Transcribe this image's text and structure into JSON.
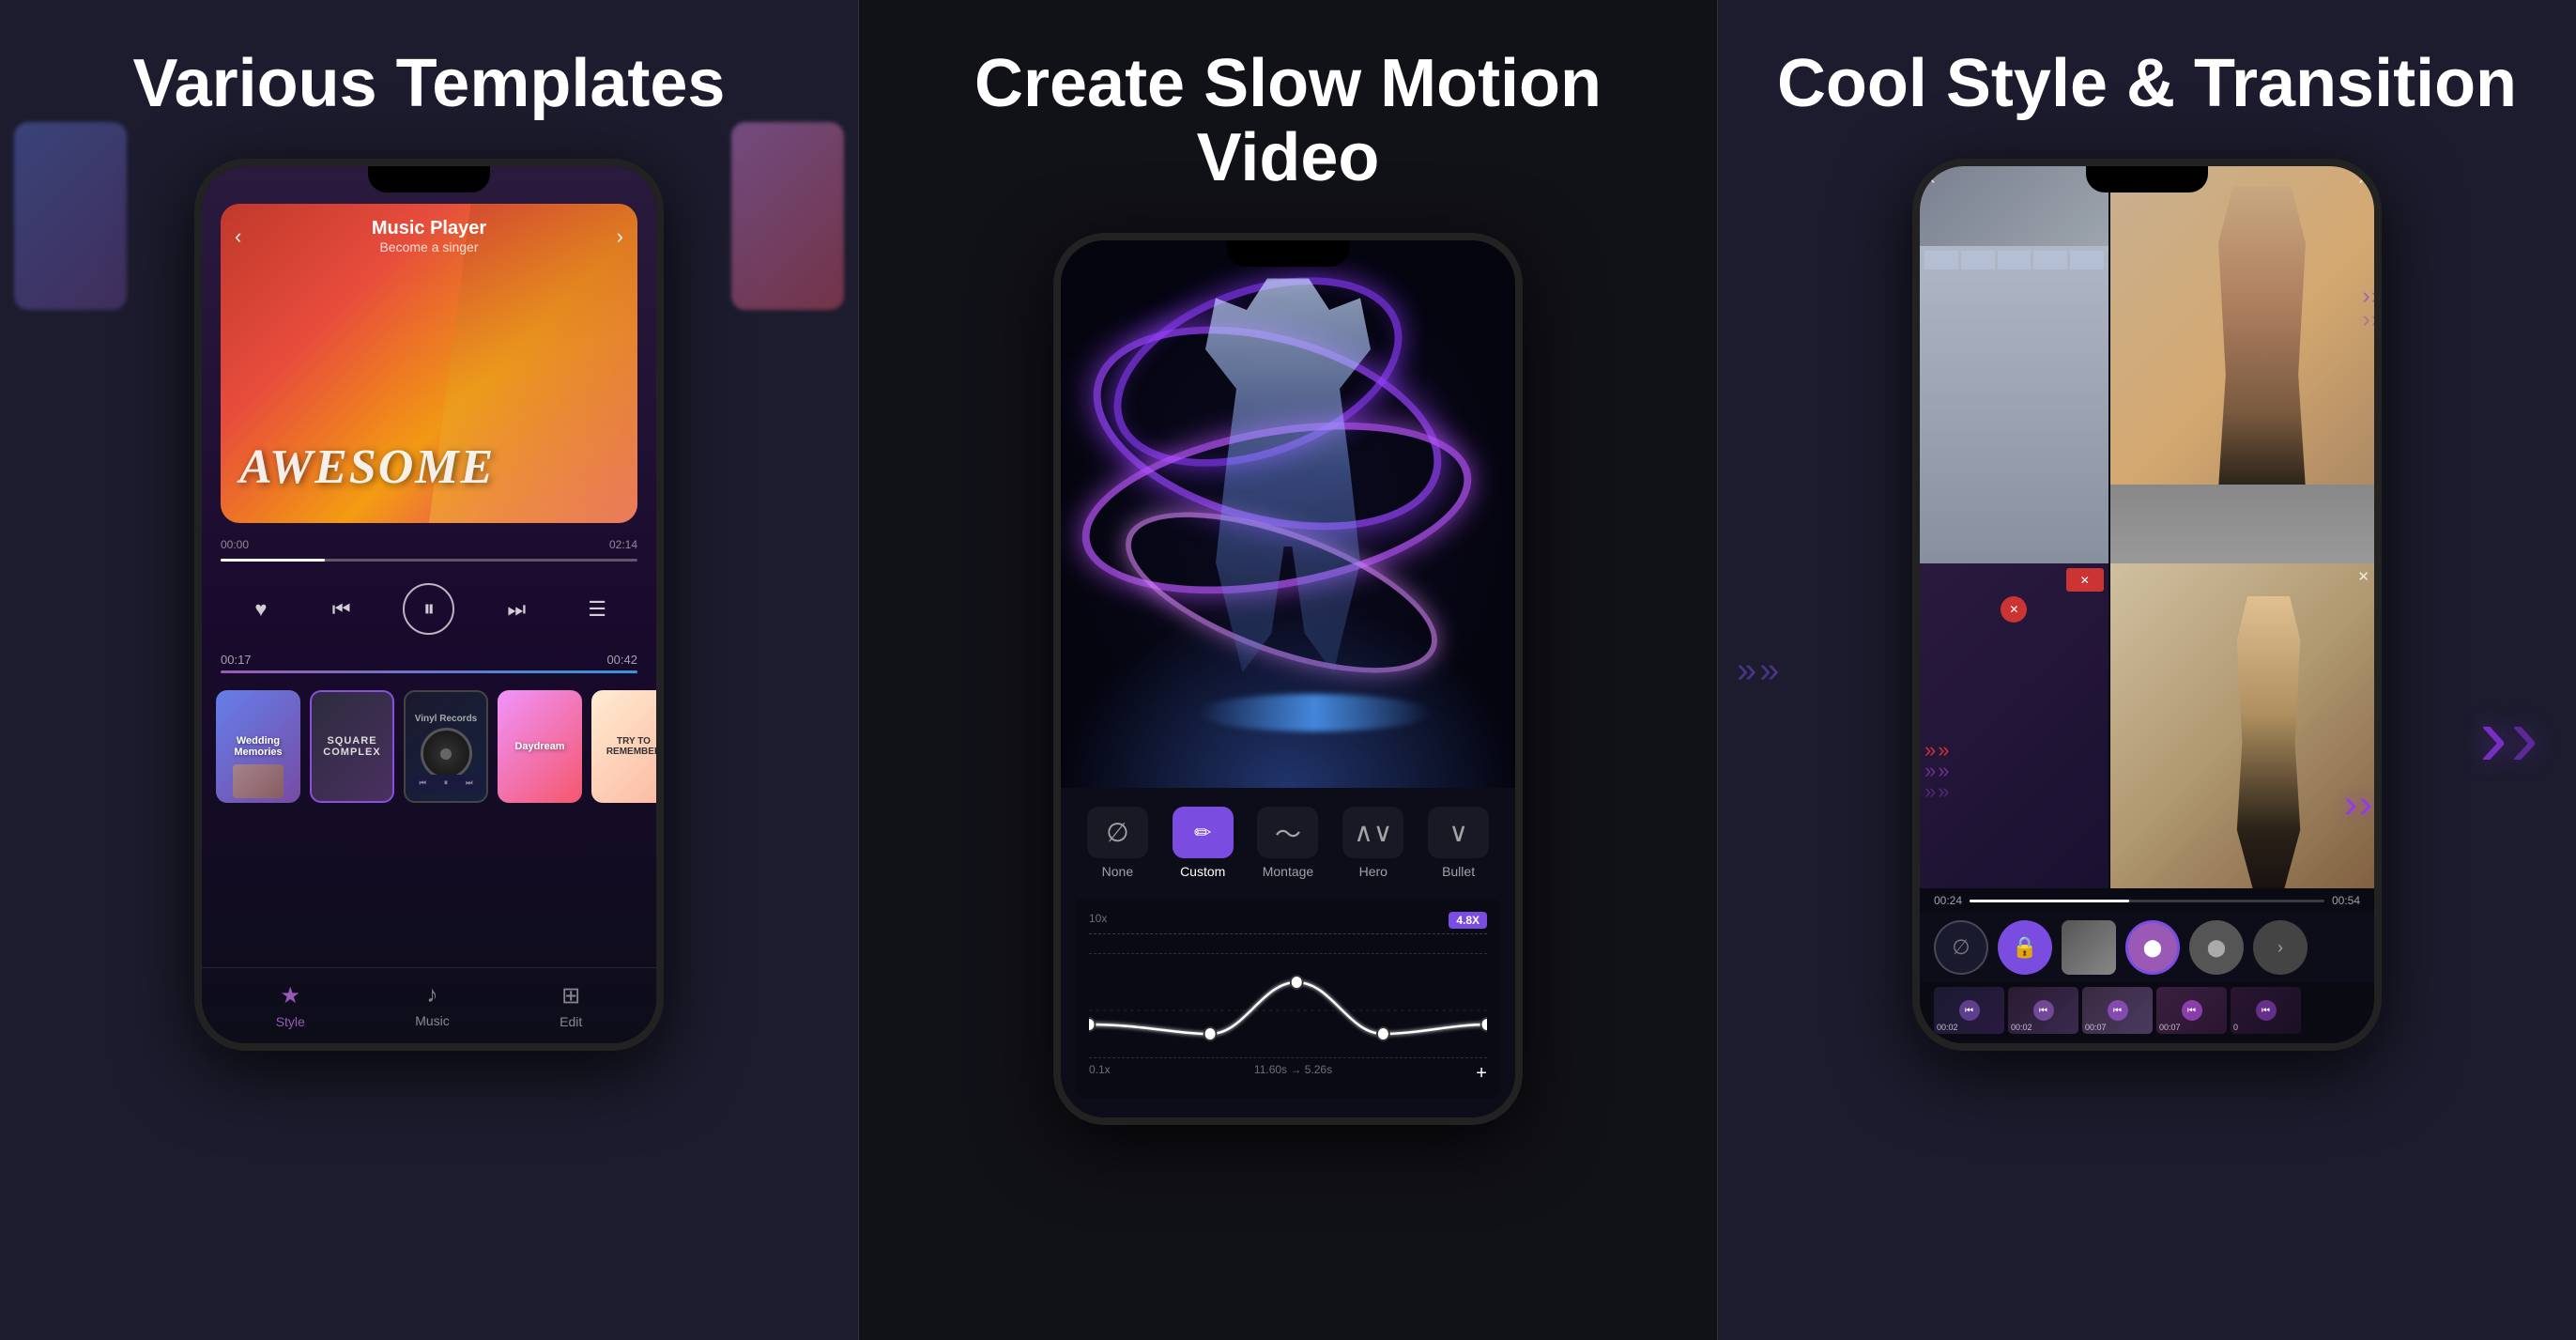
{
  "panels": [
    {
      "id": "panel-1",
      "title": "Various Templates",
      "phone": {
        "musicPlayer": {
          "trackName": "Music Player",
          "trackSub": "Become a singer",
          "awesomeText": "AWESOME",
          "timeStart": "00:17",
          "timeEnd": "00:42",
          "progressStart": "00:00",
          "progressEnd": "02:14"
        },
        "templates": [
          {
            "label": "Wedding\nMemories",
            "style": "wedding"
          },
          {
            "label": "SQUARE\nCOMPLEX",
            "style": "square"
          },
          {
            "label": "Vinyl Records",
            "style": "vinyl"
          },
          {
            "label": "Daydream",
            "style": "daydream"
          },
          {
            "label": "TRY TO\nREMEMBER",
            "style": "try"
          }
        ],
        "nav": [
          {
            "label": "Style",
            "icon": "★",
            "active": true
          },
          {
            "label": "Music",
            "icon": "♪",
            "active": false
          },
          {
            "label": "Edit",
            "icon": "⊞",
            "active": false
          }
        ]
      }
    },
    {
      "id": "panel-2",
      "title": "Create Slow Motion Video",
      "phone": {
        "speedOptions": [
          {
            "label": "None",
            "icon": "∅",
            "active": false
          },
          {
            "label": "Custom",
            "icon": "✏",
            "active": true
          },
          {
            "label": "Montage",
            "icon": "~",
            "active": false
          },
          {
            "label": "Hero",
            "icon": "^",
            "active": false
          },
          {
            "label": "Bullet",
            "icon": "∨",
            "active": false
          }
        ],
        "graph": {
          "topLeft": "10x",
          "badge": "4.8X",
          "bottomLeft": "0.1x",
          "timeLabel": "11.60s → 5.26s",
          "plusBtn": "+"
        }
      }
    },
    {
      "id": "panel-3",
      "title": "Cool Style & Transition",
      "phone": {
        "timeline": {
          "timeStart": "00:24",
          "timeEnd": "00:54"
        },
        "filmTimes": [
          "00:02",
          "00:02",
          "00:07",
          "00:07",
          "0"
        ]
      }
    }
  ],
  "icons": {
    "heart": "♥",
    "prev": "⏮",
    "pause": "⏸",
    "next": "⏭",
    "list": "☰",
    "arrowLeft": "‹",
    "arrowRight": "›",
    "chevronDouble": "»",
    "plus": "+",
    "close": "✕"
  }
}
